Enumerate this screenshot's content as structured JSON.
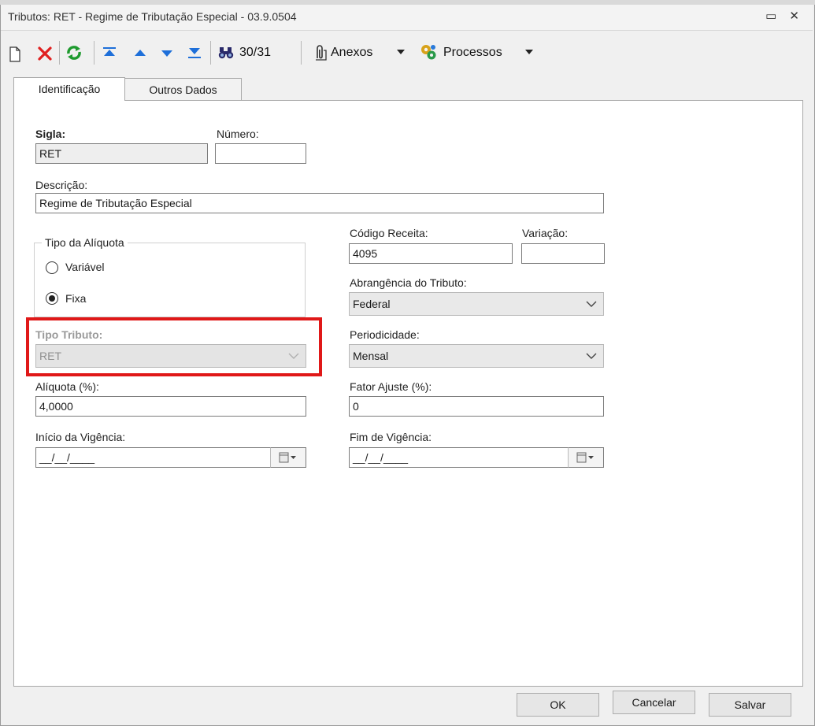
{
  "window": {
    "title": "Tributos: RET - Regime de Tributação Especial - 03.9.0504",
    "controls": "▭ ✕"
  },
  "toolbar": {
    "new_icon": "new-document-icon",
    "delete_icon": "delete-icon",
    "refresh_icon": "refresh-icon",
    "first_icon": "first-record-icon",
    "prev_icon": "previous-record-icon",
    "next_icon": "next-record-icon",
    "last_icon": "last-record-icon",
    "find_icon": "binoculars-icon",
    "record_counter": "30/31",
    "attachments_label": "Anexos",
    "processes_label": "Processos"
  },
  "tabs": [
    {
      "label": "Identificação"
    },
    {
      "label": "Outros Dados"
    }
  ],
  "form": {
    "sigla_label": "Sigla:",
    "sigla_value": "RET",
    "numero_label": "Número:",
    "numero_value": "",
    "descricao_label": "Descrição:",
    "descricao_value": "Regime de Tributação Especial",
    "tipo_aliquota_label": "Tipo da Alíquota",
    "radio_variavel": "Variável",
    "radio_fixa": "Fixa",
    "tipo_tributo_label": "Tipo Tributo:",
    "tipo_tributo_value": "RET",
    "aliquota_label": "Alíquota (%):",
    "aliquota_value": "4,0000",
    "inicio_label": "Início da Vigência:",
    "inicio_value": "__/__/____",
    "codigo_label": "Código Receita:",
    "codigo_value": "4095",
    "variacao_label": "Variação:",
    "variacao_value": "",
    "abrangencia_label": "Abrangência do Tributo:",
    "abrangencia_value": "Federal",
    "periodicidade_label": "Periodicidade:",
    "periodicidade_value": "Mensal",
    "fator_label": "Fator Ajuste (%):",
    "fator_value": "0",
    "fim_label": "Fim de Vigência:",
    "fim_value": "__/__/____"
  },
  "buttons": {
    "ok": "OK",
    "cancel": "Cancelar",
    "save": "Salvar"
  },
  "colors": {
    "highlight": "#e01818",
    "delete": "#e02020",
    "refresh": "#1e9a2e",
    "nav": "#1e6fd9"
  }
}
